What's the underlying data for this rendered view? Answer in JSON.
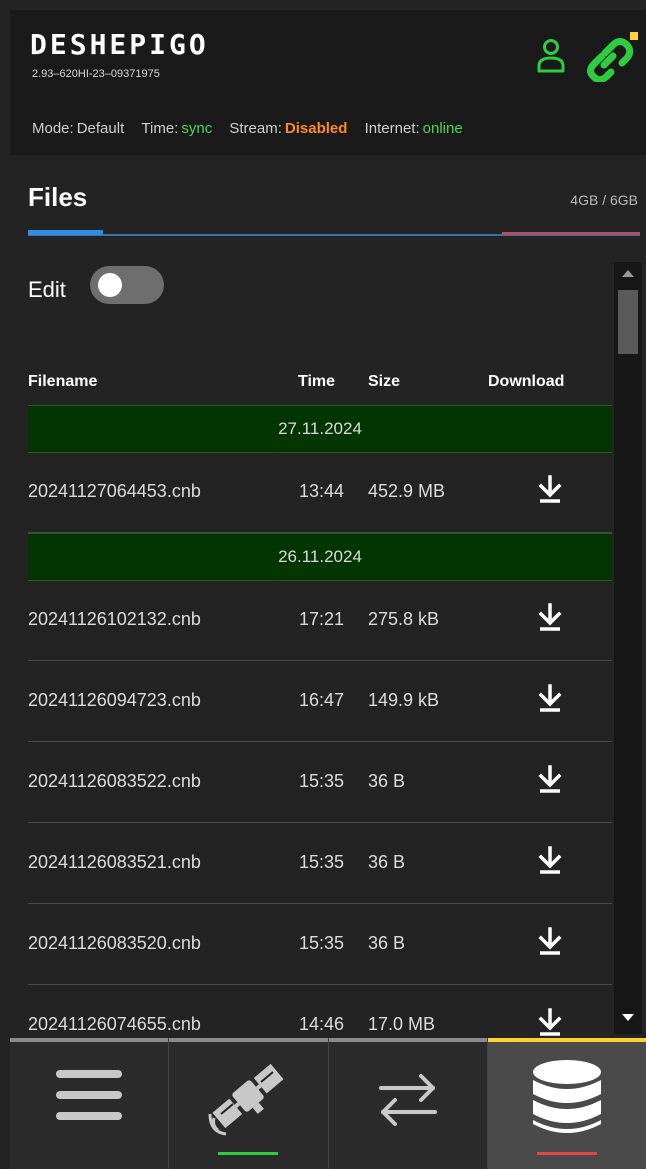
{
  "header": {
    "brand": "DESHEPIGO",
    "version": "2.93–620HI-23–09371975",
    "icons": {
      "user": "user-icon",
      "connection": "link-icon"
    },
    "colors": {
      "icon_green": "#2ecc40",
      "badge_yellow": "#ffd233"
    }
  },
  "status": {
    "mode_label": "Mode:",
    "mode_value": "Default",
    "time_label": "Time:",
    "time_value": "sync",
    "stream_label": "Stream:",
    "stream_value": "Disabled",
    "internet_label": "Internet:",
    "internet_value": "online",
    "colors": {
      "ok": "#4fd44f",
      "warn": "#ff8a1c"
    }
  },
  "files": {
    "title": "Files",
    "storage": "4GB / 6GB",
    "edit_label": "Edit",
    "edit_enabled": false,
    "columns": {
      "filename": "Filename",
      "time": "Time",
      "size": "Size",
      "download": "Download"
    },
    "groups": [
      {
        "date": "27.11.2024",
        "rows": [
          {
            "filename": "20241127064453.cnb",
            "time": "13:44",
            "size": "452.9 MB"
          }
        ]
      },
      {
        "date": "26.11.2024",
        "rows": [
          {
            "filename": "20241126102132.cnb",
            "time": "17:21",
            "size": "275.8 kB"
          },
          {
            "filename": "20241126094723.cnb",
            "time": "16:47",
            "size": "149.9 kB"
          },
          {
            "filename": "20241126083522.cnb",
            "time": "15:35",
            "size": "36 B"
          },
          {
            "filename": "20241126083521.cnb",
            "time": "15:35",
            "size": "36 B"
          },
          {
            "filename": "20241126083520.cnb",
            "time": "15:35",
            "size": "36 B"
          },
          {
            "filename": "20241126074655.cnb",
            "time": "14:46",
            "size": "17.0 MB"
          }
        ]
      }
    ],
    "download_icon": "download-arrow-icon",
    "date_band_color": "#023502"
  },
  "nav": {
    "items": [
      {
        "icon": "menu-icon",
        "active": false
      },
      {
        "icon": "satellite-icon",
        "active": false,
        "indicator": "#2ecc40"
      },
      {
        "icon": "transfer-arrows-icon",
        "active": false
      },
      {
        "icon": "database-icon",
        "active": true,
        "indicator": "#e04848"
      }
    ],
    "active_color": "#ffd233"
  }
}
